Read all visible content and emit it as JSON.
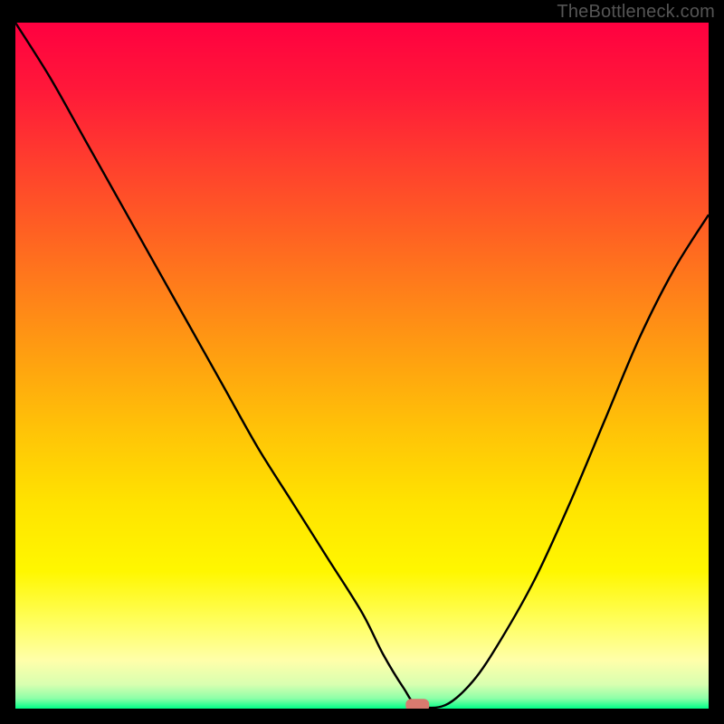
{
  "watermark": "TheBottleneck.com",
  "chart_data": {
    "type": "line",
    "title": "",
    "xlabel": "",
    "ylabel": "",
    "xlim": [
      0,
      100
    ],
    "ylim": [
      0,
      100
    ],
    "grid": false,
    "legend": false,
    "background": {
      "type": "vertical-gradient",
      "stops": [
        {
          "pos": 0.0,
          "color": "#ff0040"
        },
        {
          "pos": 0.1,
          "color": "#ff1939"
        },
        {
          "pos": 0.2,
          "color": "#ff3d2e"
        },
        {
          "pos": 0.3,
          "color": "#ff5f23"
        },
        {
          "pos": 0.4,
          "color": "#ff8219"
        },
        {
          "pos": 0.5,
          "color": "#ffa40f"
        },
        {
          "pos": 0.6,
          "color": "#ffc507"
        },
        {
          "pos": 0.7,
          "color": "#ffe300"
        },
        {
          "pos": 0.8,
          "color": "#fff700"
        },
        {
          "pos": 0.88,
          "color": "#ffff66"
        },
        {
          "pos": 0.93,
          "color": "#ffffaa"
        },
        {
          "pos": 0.965,
          "color": "#d8ffb0"
        },
        {
          "pos": 0.985,
          "color": "#8effa8"
        },
        {
          "pos": 1.0,
          "color": "#00ff88"
        }
      ]
    },
    "series": [
      {
        "name": "bottleneck-curve",
        "color": "#000000",
        "x": [
          0,
          5,
          10,
          15,
          20,
          25,
          30,
          35,
          40,
          45,
          50,
          53,
          56,
          58,
          62,
          66,
          70,
          75,
          80,
          85,
          90,
          95,
          100
        ],
        "y": [
          100,
          92,
          83,
          74,
          65,
          56,
          47,
          38,
          30,
          22,
          14,
          8,
          3,
          0.5,
          0.5,
          4,
          10,
          19,
          30,
          42,
          54,
          64,
          72
        ]
      }
    ],
    "marker": {
      "name": "optimal-point",
      "x": 58,
      "y": 0.5,
      "color": "#d87a6f",
      "shape": "rounded-rect"
    }
  },
  "colors": {
    "frame": "#000000",
    "curve": "#000000",
    "marker": "#d87a6f",
    "watermark": "#555555"
  }
}
